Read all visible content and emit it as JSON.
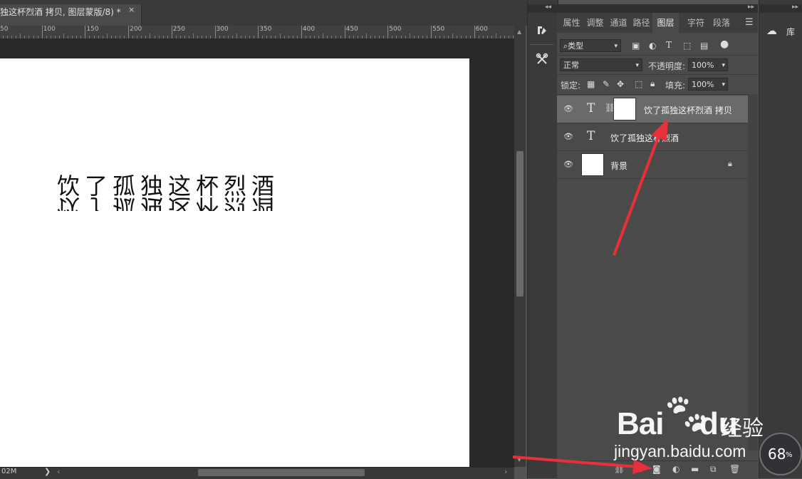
{
  "document": {
    "tab_title": "独这杯烈酒 拷贝, 图层蒙版/8) *",
    "close_glyph": "×"
  },
  "ruler": {
    "labels": [
      "50",
      "100",
      "150",
      "200",
      "250",
      "300",
      "350",
      "400",
      "450",
      "500",
      "550",
      "600"
    ]
  },
  "canvas": {
    "text_line": "饮了孤独这杯烈酒",
    "reflected_line": "饮了孤独这杯烈酒"
  },
  "statusbar": {
    "doc_size": "02M",
    "menu_arrow": "❯",
    "scroll_left": "‹",
    "scroll_right": "›"
  },
  "toolstrip": {
    "icons": [
      "history-brush-icon",
      "tools-icon"
    ]
  },
  "layers_panel": {
    "tabs": [
      "属性",
      "调整",
      "通道",
      "路径",
      "图层",
      "字符",
      "段落"
    ],
    "active_tab": "图层",
    "filter": {
      "label": "类型",
      "search_glyph": "⌕"
    },
    "blend_mode": "正常",
    "opacity_label": "不透明度:",
    "opacity_value": "100%",
    "lock_label": "锁定:",
    "fill_label": "填充:",
    "fill_value": "100%",
    "layers": [
      {
        "name": "饮了孤独这杯烈酒 拷贝",
        "type_glyph": "T",
        "selected": true,
        "has_mask": true
      },
      {
        "name": "饮了孤独这杯烈酒",
        "type_glyph": "T",
        "selected": false,
        "has_mask": false
      },
      {
        "name": "背景",
        "type_glyph": "",
        "selected": false,
        "locked": true
      }
    ],
    "bottom_icons": [
      "link-icon",
      "fx-icon",
      "mask-icon",
      "adjustment-icon",
      "folder-icon",
      "new-layer-icon",
      "trash-icon"
    ]
  },
  "library": {
    "label": "库"
  },
  "watermark": {
    "brand_bai": "Bai",
    "brand_du": "du",
    "brand_jingyan": "经验",
    "url": "jingyan.baidu.com"
  },
  "gauge": {
    "value": "68",
    "unit": "%"
  },
  "colors": {
    "panel_bg": "#4a4a4a",
    "selected_layer": "#6a6a6a",
    "pasteboard": "#282828",
    "arrow_red": "#e8303a"
  }
}
